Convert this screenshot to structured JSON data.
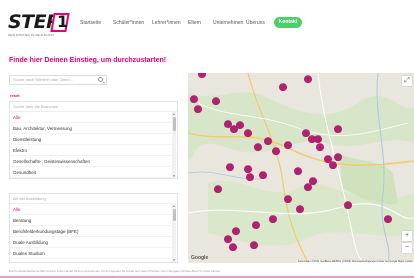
{
  "brand": {
    "logo_text": "STEP",
    "logo_mark": "1",
    "logo_sub": "DEIN EINSTIEG IN DIE ZUKUNFT",
    "accent": "#e5007e",
    "cta_color": "#4ccf6b"
  },
  "nav": {
    "items": [
      "Startseite",
      "Schüler*innen",
      "Lehrer*innen",
      "Eltern",
      "Unternehmen",
      "Überuns"
    ],
    "cta": "Kontakt"
  },
  "headline": "Finde hier Deinen Einstieg, um durchzustarten!",
  "search": {
    "placeholder": "Suche nach Wörtern oder Orten...",
    "icon": "search-icon"
  },
  "reset_label": "reset",
  "branches": {
    "header": "Suche über die Branchen",
    "items": [
      "Alle",
      "Bau, Architektur, Vermessung",
      "Dienstleistung",
      "Elektro",
      "Gesellschafts-, Geisteswissenschaften",
      "Gesundheit"
    ],
    "selected": 0
  },
  "types": {
    "header": "Art der Ausbildung",
    "items": [
      "Alle",
      "Beratung",
      "Berufsfelderkundungstage (BFE)",
      "Duale Ausbildung",
      "Duales Studium"
    ],
    "selected": 0
  },
  "map": {
    "zoom_in": "+",
    "zoom_out": "−",
    "fullscreen": "⤢",
    "google_label": "Google",
    "attribution": "Kartendaten ©2021 GeoBasis-DE/BKG (©2009) Nutzungsbedingungen Fehler bei Google Maps melden",
    "marker_color": "#b0216f"
  },
  "footer": "Die Kreishandwerkerschaft und der Kreis Höxter fördern gemeinsam mit der Agentur für Arbeit und vielen Partnern den Übergang Schule-Beruf im Kreis Höxter."
}
